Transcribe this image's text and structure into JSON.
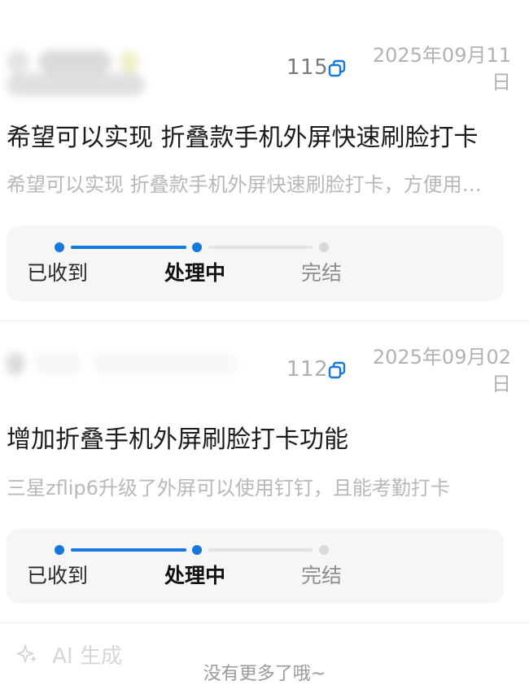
{
  "feedback_list": [
    {
      "id_suffix": "115",
      "date": "2025年09月11日",
      "title": "希望可以实现 折叠款手机外屏快速刷脸打卡",
      "description": "希望可以实现 折叠款手机外屏快速刷脸打卡，方便用户使用",
      "progress": {
        "steps": [
          "已收到",
          "处理中",
          "完结"
        ],
        "current_step": 2
      }
    },
    {
      "id_suffix": "112",
      "date": "2025年09月02日",
      "title": "增加折叠手机外屏刷脸打卡功能",
      "description": "三星zflip6升级了外屏可以使用钉钉，且能考勤打卡",
      "progress": {
        "steps": [
          "已收到",
          "处理中",
          "完结"
        ],
        "current_step": 2
      }
    }
  ],
  "ai_badge": {
    "icon": "sparkle-icon",
    "label": "AI 生成"
  },
  "footer": {
    "no_more_text": "没有更多了哦~"
  },
  "colors": {
    "accent": "#1577e0",
    "muted": "#b8b8b8"
  }
}
